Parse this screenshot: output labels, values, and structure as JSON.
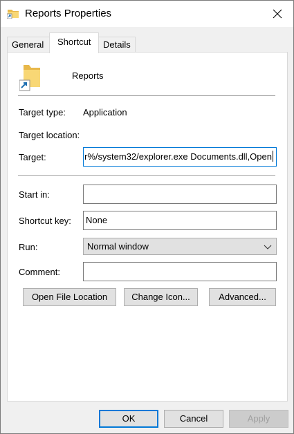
{
  "window": {
    "title": "Reports Properties"
  },
  "tabs": [
    {
      "label": "General"
    },
    {
      "label": "Shortcut"
    },
    {
      "label": "Details"
    }
  ],
  "shortcut": {
    "name": "Reports",
    "target_type_label": "Target type:",
    "target_type_value": "Application",
    "target_location_label": "Target location:",
    "target_location_value": "",
    "target_label": "Target:",
    "target_value_visible": "r%/system32/explorer.exe Documents.dll,Open",
    "start_in_label": "Start in:",
    "start_in_value": "",
    "shortcut_key_label": "Shortcut key:",
    "shortcut_key_value": "None",
    "run_label": "Run:",
    "run_value": "Normal window",
    "comment_label": "Comment:",
    "comment_value": "",
    "buttons": {
      "open_file_location": "Open File Location",
      "change_icon": "Change Icon...",
      "advanced": "Advanced..."
    }
  },
  "footer": {
    "ok": "OK",
    "cancel": "Cancel",
    "apply": "Apply"
  },
  "colors": {
    "accent": "#0078d7",
    "folder": "#f8d775",
    "shortcut_arrow": "#1f6fb2"
  },
  "icons": {
    "title": "folder-shortcut-icon",
    "close": "close-icon",
    "shortcut_big": "folder-shortcut-icon",
    "run_dropdown": "chevron-down-icon"
  }
}
